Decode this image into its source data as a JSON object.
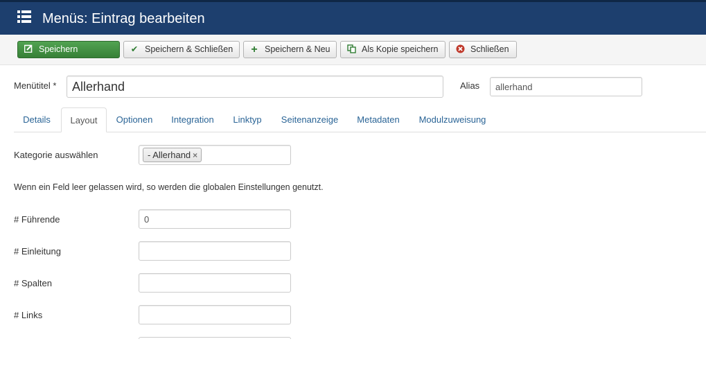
{
  "header": {
    "title": "Menüs: Eintrag bearbeiten",
    "icon": "list-icon"
  },
  "toolbar": {
    "save": "Speichern",
    "save_close": "Speichern & Schließen",
    "save_new": "Speichern & Neu",
    "save_copy": "Als Kopie speichern",
    "close": "Schließen"
  },
  "form": {
    "title_label": "Menütitel *",
    "title_value": "Allerhand",
    "alias_label": "Alias",
    "alias_value": "allerhand"
  },
  "tabs": [
    "Details",
    "Layout",
    "Optionen",
    "Integration",
    "Linktyp",
    "Seitenanzeige",
    "Metadaten",
    "Modulzuweisung"
  ],
  "active_tab": "Layout",
  "layout": {
    "category_label": "Kategorie auswählen",
    "category_chip": "- Allerhand",
    "note": "Wenn ein Feld leer gelassen wird, so werden die globalen Einstellungen genutzt.",
    "fields": [
      {
        "label": "# Führende",
        "value": "0"
      },
      {
        "label": "# Einleitung",
        "value": ""
      },
      {
        "label": "# Spalten",
        "value": ""
      },
      {
        "label": "# Links",
        "value": ""
      }
    ]
  },
  "colors": {
    "header_bg": "#1d3f6e",
    "save_button": "#46a046",
    "link": "#2a6496"
  }
}
